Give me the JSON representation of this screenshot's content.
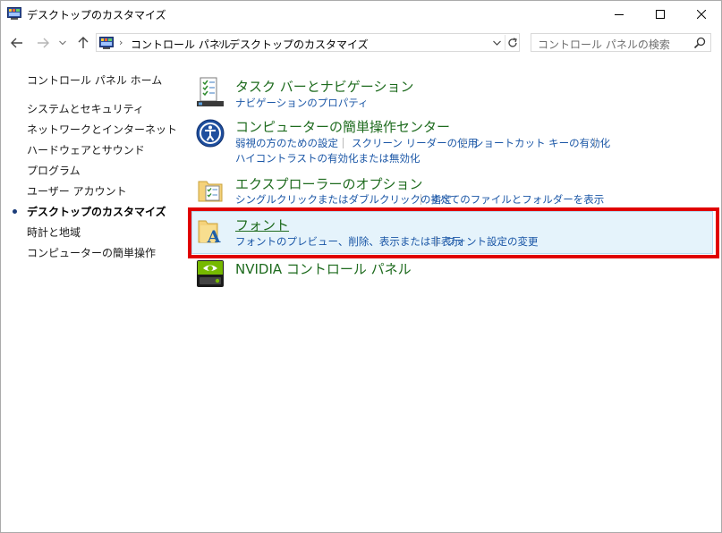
{
  "window": {
    "title": "デスクトップのカスタマイズ"
  },
  "address": {
    "crumbs": [
      "コントロール パネル",
      "デスクトップのカスタマイズ"
    ]
  },
  "search": {
    "placeholder": "コントロール パネルの検索"
  },
  "sidebar": {
    "items": [
      {
        "label": "コントロール パネル ホーム"
      },
      {
        "label": "システムとセキュリティ"
      },
      {
        "label": "ネットワークとインターネット"
      },
      {
        "label": "ハードウェアとサウンド"
      },
      {
        "label": "プログラム"
      },
      {
        "label": "ユーザー アカウント"
      },
      {
        "label": "デスクトップのカスタマイズ",
        "active": true
      },
      {
        "label": "時計と地域"
      },
      {
        "label": "コンピューターの簡単操作"
      }
    ]
  },
  "categories": [
    {
      "title": "タスク バーとナビゲーション",
      "icon": "taskbar-checklist-icon",
      "links": [
        "ナビゲーションのプロパティ"
      ]
    },
    {
      "title": "コンピューターの簡単操作センター",
      "icon": "ease-of-access-icon",
      "links": [
        "弱視の方のための設定",
        "スクリーン リーダーの使用",
        "ショートカット キーの有効化",
        "ハイコントラストの有効化または無効化"
      ]
    },
    {
      "title": "エクスプローラーのオプション",
      "icon": "folder-options-icon",
      "links": [
        "シングルクリックまたはダブルクリックの指定",
        "すべてのファイルとフォルダーを表示"
      ]
    },
    {
      "title": "フォント",
      "icon": "fonts-folder-icon",
      "links": [
        "フォントのプレビュー、削除、表示または非表示",
        "フォント設定の変更"
      ],
      "highlighted": true
    },
    {
      "title": "NVIDIA コントロール パネル",
      "icon": "nvidia-icon",
      "links": []
    }
  ],
  "colors": {
    "category_title": "#1e6b1e",
    "link": "#1a56a6",
    "highlight_bg": "#e5f3fb",
    "annotation_red": "#e00000"
  }
}
